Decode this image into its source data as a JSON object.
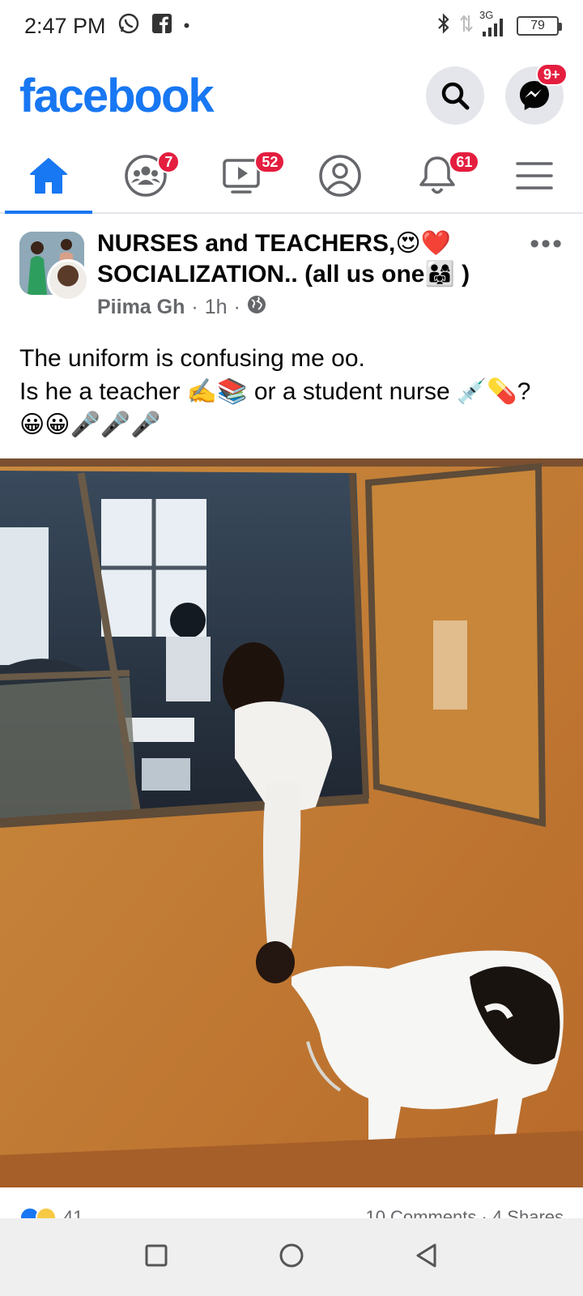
{
  "status_bar": {
    "time": "2:47 PM",
    "network": "3G",
    "battery": "79"
  },
  "header": {
    "logo": "facebook",
    "messenger_badge": "9+"
  },
  "nav": {
    "tabs": [
      {
        "name": "home",
        "badge": ""
      },
      {
        "name": "groups",
        "badge": "7"
      },
      {
        "name": "watch",
        "badge": "52"
      },
      {
        "name": "profile",
        "badge": ""
      },
      {
        "name": "notifications",
        "badge": "61"
      },
      {
        "name": "menu",
        "badge": ""
      }
    ]
  },
  "post": {
    "group_title_line1": "NURSES and TEACHERS,😍❤️",
    "group_title_line2": "SOCIALIZATION.. (all us one👨‍👩‍👧 )",
    "author": "Piima Gh",
    "time": "1h",
    "text_line1": "The uniform is confusing me oo.",
    "text_line2": "Is he a teacher ✍️📚 or a student nurse 💉💊?",
    "text_line3": "😀😀🎤🎤🎤",
    "reactions_count": "41",
    "comments_shares": "10 Comments · 4 Shares"
  },
  "colors": {
    "brand": "#1877f2",
    "badge": "#e41e3f"
  }
}
